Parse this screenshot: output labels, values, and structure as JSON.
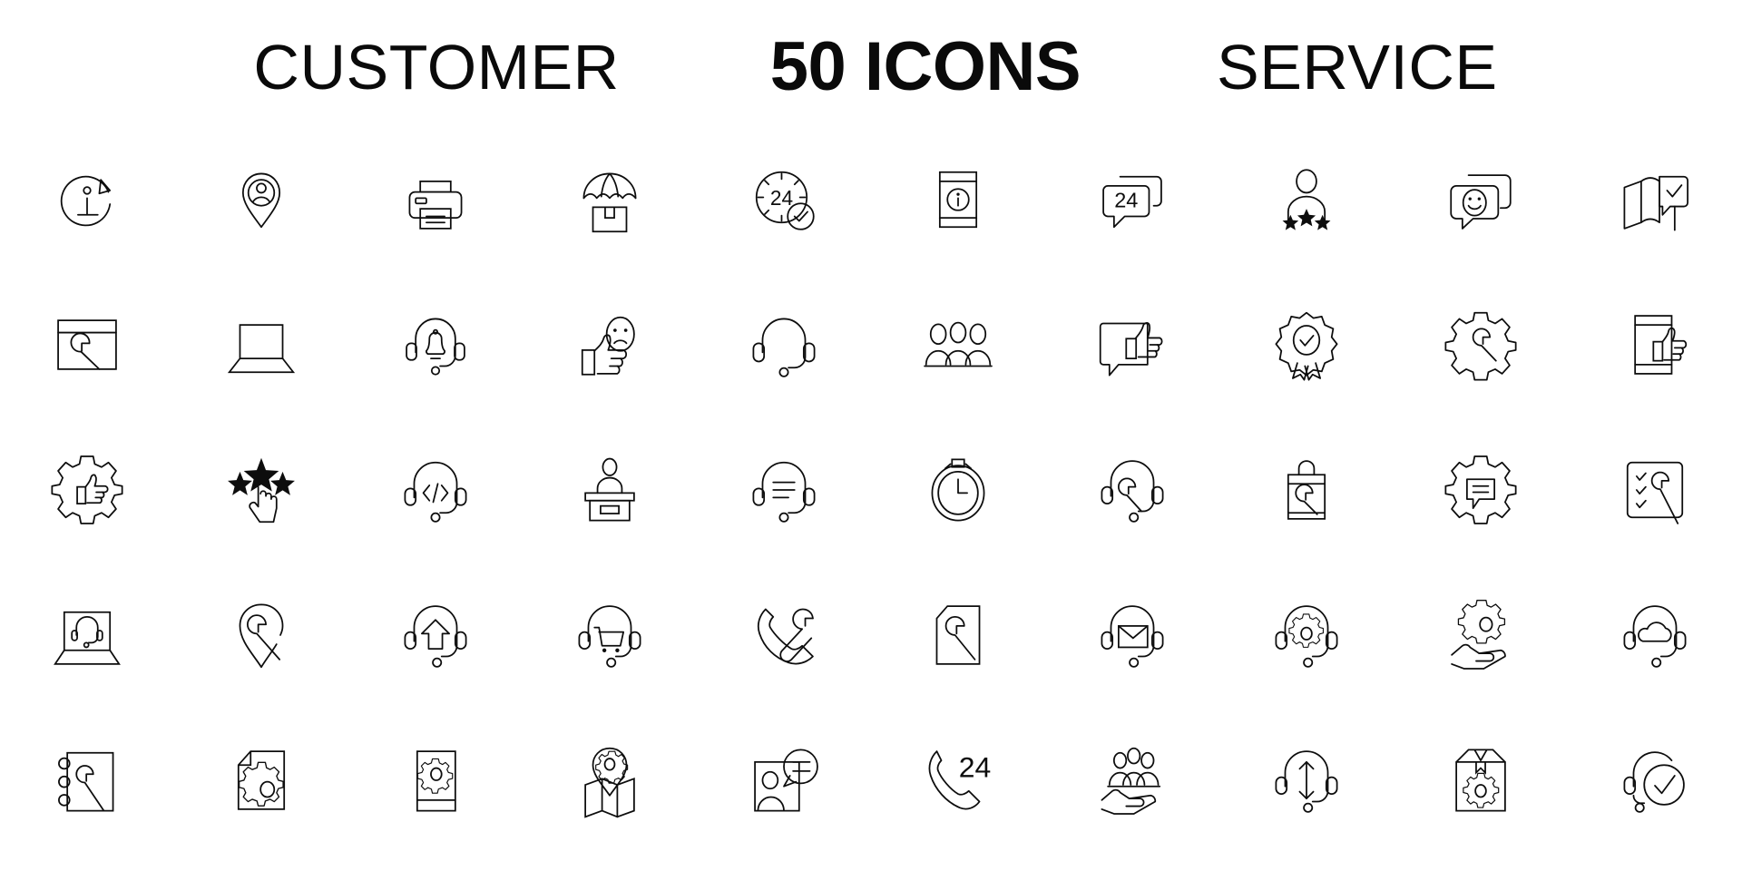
{
  "header": {
    "left_word": "CUSTOMER",
    "middle_word": "50 ICONS",
    "right_word": "SERVICE"
  },
  "style": {
    "background_color": "#ffffff",
    "stroke_color": "#0d0d0d",
    "title_color": "#0a0a0a"
  },
  "grid": {
    "columns": 10,
    "rows": 5,
    "total_icons": 50
  },
  "icons": [
    {
      "index": 1,
      "name": "info-refresh-icon",
      "label": "Information Update"
    },
    {
      "index": 2,
      "name": "location-user-pin-icon",
      "label": "User Location"
    },
    {
      "index": 3,
      "name": "printer-icon",
      "label": "Printer"
    },
    {
      "index": 4,
      "name": "package-umbrella-icon",
      "label": "Shipping Insurance"
    },
    {
      "index": 5,
      "name": "clock-24-check-icon",
      "label": "24 Hour Confirmed"
    },
    {
      "index": 6,
      "name": "mobile-info-icon",
      "label": "Mobile Information"
    },
    {
      "index": 7,
      "name": "chat-24-icon",
      "label": "24 Hour Chat"
    },
    {
      "index": 8,
      "name": "user-stars-rating-icon",
      "label": "Customer Rating"
    },
    {
      "index": 9,
      "name": "chat-smiley-icon",
      "label": "Happy Chat Feedback"
    },
    {
      "index": 10,
      "name": "open-book-check-icon",
      "label": "Verified Manual"
    },
    {
      "index": 11,
      "name": "browser-wrench-icon",
      "label": "Web Maintenance"
    },
    {
      "index": 12,
      "name": "laptop-icon",
      "label": "Laptop"
    },
    {
      "index": 13,
      "name": "headset-bell-icon",
      "label": "Support Notification"
    },
    {
      "index": 14,
      "name": "thumbs-up-sad-face-icon",
      "label": "Mixed Feedback"
    },
    {
      "index": 15,
      "name": "headset-icon",
      "label": "Headset"
    },
    {
      "index": 16,
      "name": "group-people-icon",
      "label": "Customer Group"
    },
    {
      "index": 17,
      "name": "chat-thumbs-up-icon",
      "label": "Positive Chat Feedback"
    },
    {
      "index": 18,
      "name": "award-badge-check-icon",
      "label": "Quality Award"
    },
    {
      "index": 19,
      "name": "gear-wrench-icon",
      "label": "Technical Settings"
    },
    {
      "index": 20,
      "name": "mobile-thumbs-up-icon",
      "label": "Mobile Approval"
    },
    {
      "index": 21,
      "name": "gear-thumbs-up-icon",
      "label": "Service Approval"
    },
    {
      "index": 22,
      "name": "stars-click-rating-icon",
      "label": "Star Rating Click"
    },
    {
      "index": 23,
      "name": "headset-code-icon",
      "label": "Developer Support"
    },
    {
      "index": 24,
      "name": "reception-desk-icon",
      "label": "Reception Desk"
    },
    {
      "index": 25,
      "name": "headset-chat-icon",
      "label": "Chat Support"
    },
    {
      "index": 26,
      "name": "stopwatch-icon",
      "label": "Response Time"
    },
    {
      "index": 27,
      "name": "headset-wrench-icon",
      "label": "Technical Support"
    },
    {
      "index": 28,
      "name": "shopping-bag-wrench-icon",
      "label": "Product Repair"
    },
    {
      "index": 29,
      "name": "gear-chat-icon",
      "label": "Support Settings"
    },
    {
      "index": 30,
      "name": "checklist-wrench-icon",
      "label": "Maintenance Checklist"
    },
    {
      "index": 31,
      "name": "laptop-headset-icon",
      "label": "Online Support"
    },
    {
      "index": 32,
      "name": "location-wrench-icon",
      "label": "On-site Service"
    },
    {
      "index": 33,
      "name": "headset-upgrade-icon",
      "label": "Support Upgrade"
    },
    {
      "index": 34,
      "name": "headset-cart-icon",
      "label": "Shopping Support"
    },
    {
      "index": 35,
      "name": "phone-wrench-icon",
      "label": "Phone Repair Service"
    },
    {
      "index": 36,
      "name": "document-wrench-icon",
      "label": "Service Document"
    },
    {
      "index": 37,
      "name": "headset-mail-icon",
      "label": "Email Support"
    },
    {
      "index": 38,
      "name": "headset-gear-icon",
      "label": "Support Configuration"
    },
    {
      "index": 39,
      "name": "hand-gear-icon",
      "label": "Service Care"
    },
    {
      "index": 40,
      "name": "headset-cloud-icon",
      "label": "Cloud Support"
    },
    {
      "index": 41,
      "name": "notebook-wrench-icon",
      "label": "Service Notebook"
    },
    {
      "index": 42,
      "name": "file-gear-icon",
      "label": "File Settings"
    },
    {
      "index": 43,
      "name": "manual-book-gear-icon",
      "label": "Service Manual"
    },
    {
      "index": 44,
      "name": "map-gear-pin-icon",
      "label": "Service Location Map"
    },
    {
      "index": 45,
      "name": "contact-card-chat-icon",
      "label": "Contact Support"
    },
    {
      "index": 46,
      "name": "phone-24-icon",
      "label": "24 Hour Hotline"
    },
    {
      "index": 47,
      "name": "hand-group-people-icon",
      "label": "Customer Care"
    },
    {
      "index": 48,
      "name": "headset-transfer-icon",
      "label": "Call Transfer"
    },
    {
      "index": 49,
      "name": "package-gear-icon",
      "label": "Package Service"
    },
    {
      "index": 50,
      "name": "headset-check-icon",
      "label": "Verified Support"
    }
  ],
  "icon_text_labels": {
    "clock_24": "24",
    "chat_24": "24",
    "phone_24": "24",
    "code_glyph": "</>"
  }
}
